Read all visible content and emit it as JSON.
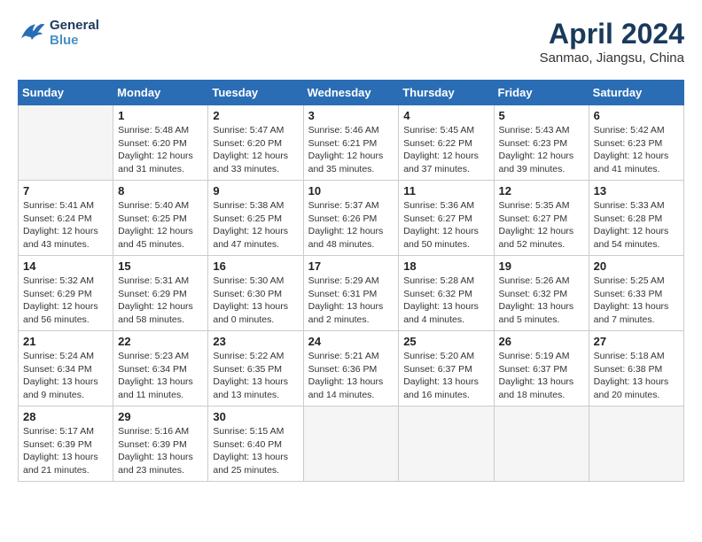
{
  "header": {
    "logo_line1": "General",
    "logo_line2": "Blue",
    "month": "April 2024",
    "location": "Sanmao, Jiangsu, China"
  },
  "days_of_week": [
    "Sunday",
    "Monday",
    "Tuesday",
    "Wednesday",
    "Thursday",
    "Friday",
    "Saturday"
  ],
  "weeks": [
    [
      {
        "num": "",
        "info": ""
      },
      {
        "num": "1",
        "info": "Sunrise: 5:48 AM\nSunset: 6:20 PM\nDaylight: 12 hours\nand 31 minutes."
      },
      {
        "num": "2",
        "info": "Sunrise: 5:47 AM\nSunset: 6:20 PM\nDaylight: 12 hours\nand 33 minutes."
      },
      {
        "num": "3",
        "info": "Sunrise: 5:46 AM\nSunset: 6:21 PM\nDaylight: 12 hours\nand 35 minutes."
      },
      {
        "num": "4",
        "info": "Sunrise: 5:45 AM\nSunset: 6:22 PM\nDaylight: 12 hours\nand 37 minutes."
      },
      {
        "num": "5",
        "info": "Sunrise: 5:43 AM\nSunset: 6:23 PM\nDaylight: 12 hours\nand 39 minutes."
      },
      {
        "num": "6",
        "info": "Sunrise: 5:42 AM\nSunset: 6:23 PM\nDaylight: 12 hours\nand 41 minutes."
      }
    ],
    [
      {
        "num": "7",
        "info": "Sunrise: 5:41 AM\nSunset: 6:24 PM\nDaylight: 12 hours\nand 43 minutes."
      },
      {
        "num": "8",
        "info": "Sunrise: 5:40 AM\nSunset: 6:25 PM\nDaylight: 12 hours\nand 45 minutes."
      },
      {
        "num": "9",
        "info": "Sunrise: 5:38 AM\nSunset: 6:25 PM\nDaylight: 12 hours\nand 47 minutes."
      },
      {
        "num": "10",
        "info": "Sunrise: 5:37 AM\nSunset: 6:26 PM\nDaylight: 12 hours\nand 48 minutes."
      },
      {
        "num": "11",
        "info": "Sunrise: 5:36 AM\nSunset: 6:27 PM\nDaylight: 12 hours\nand 50 minutes."
      },
      {
        "num": "12",
        "info": "Sunrise: 5:35 AM\nSunset: 6:27 PM\nDaylight: 12 hours\nand 52 minutes."
      },
      {
        "num": "13",
        "info": "Sunrise: 5:33 AM\nSunset: 6:28 PM\nDaylight: 12 hours\nand 54 minutes."
      }
    ],
    [
      {
        "num": "14",
        "info": "Sunrise: 5:32 AM\nSunset: 6:29 PM\nDaylight: 12 hours\nand 56 minutes."
      },
      {
        "num": "15",
        "info": "Sunrise: 5:31 AM\nSunset: 6:29 PM\nDaylight: 12 hours\nand 58 minutes."
      },
      {
        "num": "16",
        "info": "Sunrise: 5:30 AM\nSunset: 6:30 PM\nDaylight: 13 hours\nand 0 minutes."
      },
      {
        "num": "17",
        "info": "Sunrise: 5:29 AM\nSunset: 6:31 PM\nDaylight: 13 hours\nand 2 minutes."
      },
      {
        "num": "18",
        "info": "Sunrise: 5:28 AM\nSunset: 6:32 PM\nDaylight: 13 hours\nand 4 minutes."
      },
      {
        "num": "19",
        "info": "Sunrise: 5:26 AM\nSunset: 6:32 PM\nDaylight: 13 hours\nand 5 minutes."
      },
      {
        "num": "20",
        "info": "Sunrise: 5:25 AM\nSunset: 6:33 PM\nDaylight: 13 hours\nand 7 minutes."
      }
    ],
    [
      {
        "num": "21",
        "info": "Sunrise: 5:24 AM\nSunset: 6:34 PM\nDaylight: 13 hours\nand 9 minutes."
      },
      {
        "num": "22",
        "info": "Sunrise: 5:23 AM\nSunset: 6:34 PM\nDaylight: 13 hours\nand 11 minutes."
      },
      {
        "num": "23",
        "info": "Sunrise: 5:22 AM\nSunset: 6:35 PM\nDaylight: 13 hours\nand 13 minutes."
      },
      {
        "num": "24",
        "info": "Sunrise: 5:21 AM\nSunset: 6:36 PM\nDaylight: 13 hours\nand 14 minutes."
      },
      {
        "num": "25",
        "info": "Sunrise: 5:20 AM\nSunset: 6:37 PM\nDaylight: 13 hours\nand 16 minutes."
      },
      {
        "num": "26",
        "info": "Sunrise: 5:19 AM\nSunset: 6:37 PM\nDaylight: 13 hours\nand 18 minutes."
      },
      {
        "num": "27",
        "info": "Sunrise: 5:18 AM\nSunset: 6:38 PM\nDaylight: 13 hours\nand 20 minutes."
      }
    ],
    [
      {
        "num": "28",
        "info": "Sunrise: 5:17 AM\nSunset: 6:39 PM\nDaylight: 13 hours\nand 21 minutes."
      },
      {
        "num": "29",
        "info": "Sunrise: 5:16 AM\nSunset: 6:39 PM\nDaylight: 13 hours\nand 23 minutes."
      },
      {
        "num": "30",
        "info": "Sunrise: 5:15 AM\nSunset: 6:40 PM\nDaylight: 13 hours\nand 25 minutes."
      },
      {
        "num": "",
        "info": ""
      },
      {
        "num": "",
        "info": ""
      },
      {
        "num": "",
        "info": ""
      },
      {
        "num": "",
        "info": ""
      }
    ]
  ]
}
